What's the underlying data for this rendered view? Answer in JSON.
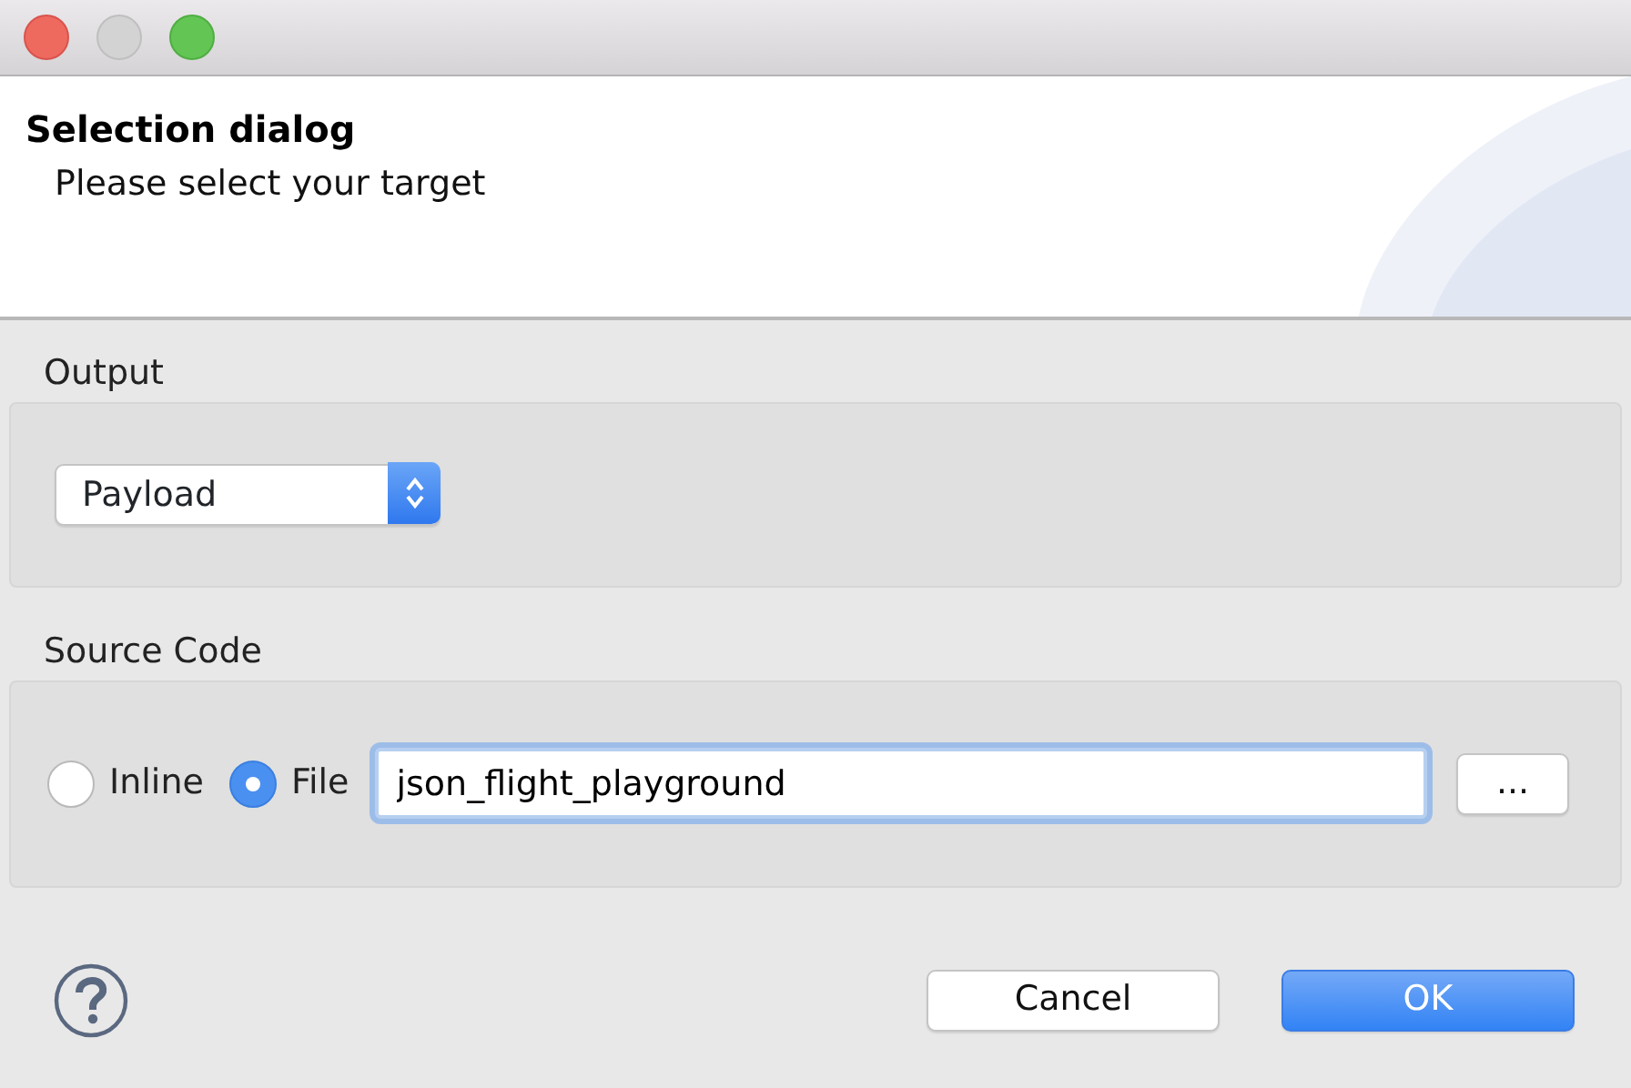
{
  "window": {
    "title": "Selection dialog",
    "subtitle": "Please select your target"
  },
  "output": {
    "label": "Output",
    "dropdown": {
      "value": "Payload"
    }
  },
  "source_code": {
    "label": "Source Code",
    "options": [
      {
        "label": "Inline",
        "selected": false
      },
      {
        "label": "File",
        "selected": true
      }
    ],
    "file_field": {
      "value": "json_flight_playground",
      "focused": true
    },
    "browse_button": "..."
  },
  "buttons": [
    {
      "label": "Cancel",
      "kind": "secondary"
    },
    {
      "label": "OK",
      "kind": "primary"
    }
  ]
}
